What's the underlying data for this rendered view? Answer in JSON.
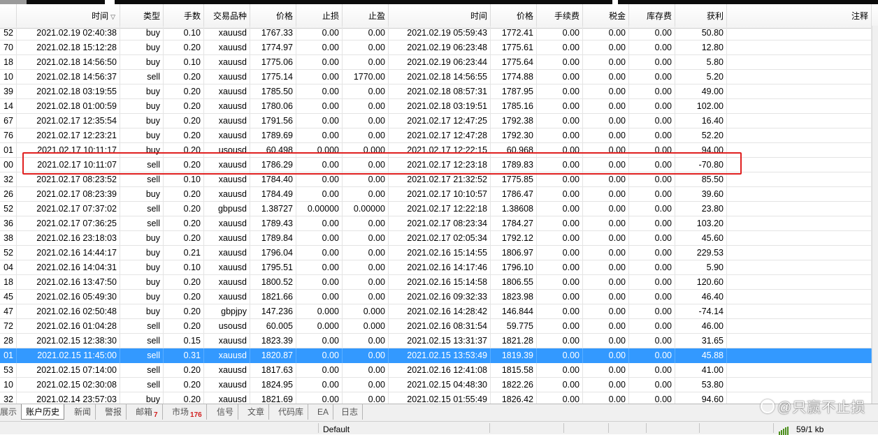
{
  "columns": [
    {
      "key": "order",
      "label": ""
    },
    {
      "key": "open_time",
      "label": "时间"
    },
    {
      "key": "type",
      "label": "类型"
    },
    {
      "key": "lots",
      "label": "手数"
    },
    {
      "key": "symbol",
      "label": "交易品种"
    },
    {
      "key": "open_price",
      "label": "价格"
    },
    {
      "key": "sl",
      "label": "止损"
    },
    {
      "key": "tp",
      "label": "止盈"
    },
    {
      "key": "close_time",
      "label": "时间"
    },
    {
      "key": "close_price",
      "label": "价格"
    },
    {
      "key": "commission",
      "label": "手续费"
    },
    {
      "key": "tax",
      "label": "税金"
    },
    {
      "key": "swap",
      "label": "库存费"
    },
    {
      "key": "profit",
      "label": "获利"
    },
    {
      "key": "comment",
      "label": "注释"
    }
  ],
  "sort_icon": "sort-desc-icon",
  "sort_glyph": "▽",
  "rows": [
    [
      "52",
      "2021.02.19 02:40:38",
      "buy",
      "0.10",
      "xauusd",
      "1767.33",
      "0.00",
      "0.00",
      "2021.02.19 05:59:43",
      "1772.41",
      "0.00",
      "0.00",
      "0.00",
      "50.80",
      ""
    ],
    [
      "70",
      "2021.02.18 15:12:28",
      "buy",
      "0.20",
      "xauusd",
      "1774.97",
      "0.00",
      "0.00",
      "2021.02.19 06:23:48",
      "1775.61",
      "0.00",
      "0.00",
      "0.00",
      "12.80",
      ""
    ],
    [
      "18",
      "2021.02.18 14:56:50",
      "buy",
      "0.10",
      "xauusd",
      "1775.06",
      "0.00",
      "0.00",
      "2021.02.19 06:23:44",
      "1775.64",
      "0.00",
      "0.00",
      "0.00",
      "5.80",
      ""
    ],
    [
      "10",
      "2021.02.18 14:56:37",
      "sell",
      "0.20",
      "xauusd",
      "1775.14",
      "0.00",
      "1770.00",
      "2021.02.18 14:56:55",
      "1774.88",
      "0.00",
      "0.00",
      "0.00",
      "5.20",
      ""
    ],
    [
      "39",
      "2021.02.18 03:19:55",
      "buy",
      "0.20",
      "xauusd",
      "1785.50",
      "0.00",
      "0.00",
      "2021.02.18 08:57:31",
      "1787.95",
      "0.00",
      "0.00",
      "0.00",
      "49.00",
      ""
    ],
    [
      "14",
      "2021.02.18 01:00:59",
      "buy",
      "0.20",
      "xauusd",
      "1780.06",
      "0.00",
      "0.00",
      "2021.02.18 03:19:51",
      "1785.16",
      "0.00",
      "0.00",
      "0.00",
      "102.00",
      ""
    ],
    [
      "67",
      "2021.02.17 12:35:54",
      "buy",
      "0.20",
      "xauusd",
      "1791.56",
      "0.00",
      "0.00",
      "2021.02.17 12:47:25",
      "1792.38",
      "0.00",
      "0.00",
      "0.00",
      "16.40",
      ""
    ],
    [
      "76",
      "2021.02.17 12:23:21",
      "buy",
      "0.20",
      "xauusd",
      "1789.69",
      "0.00",
      "0.00",
      "2021.02.17 12:47:28",
      "1792.30",
      "0.00",
      "0.00",
      "0.00",
      "52.20",
      ""
    ],
    [
      "01",
      "2021.02.17 10:11:17",
      "buy",
      "0.20",
      "usousd",
      "60.498",
      "0.000",
      "0.000",
      "2021.02.17 12:22:15",
      "60.968",
      "0.00",
      "0.00",
      "0.00",
      "94.00",
      ""
    ],
    [
      "00",
      "2021.02.17 10:11:07",
      "sell",
      "0.20",
      "xauusd",
      "1786.29",
      "0.00",
      "0.00",
      "2021.02.17 12:23:18",
      "1789.83",
      "0.00",
      "0.00",
      "0.00",
      "-70.80",
      ""
    ],
    [
      "32",
      "2021.02.17 08:23:52",
      "sell",
      "0.10",
      "xauusd",
      "1784.40",
      "0.00",
      "0.00",
      "2021.02.17 21:32:52",
      "1775.85",
      "0.00",
      "0.00",
      "0.00",
      "85.50",
      ""
    ],
    [
      "26",
      "2021.02.17 08:23:39",
      "buy",
      "0.20",
      "xauusd",
      "1784.49",
      "0.00",
      "0.00",
      "2021.02.17 10:10:57",
      "1786.47",
      "0.00",
      "0.00",
      "0.00",
      "39.60",
      ""
    ],
    [
      "52",
      "2021.02.17 07:37:02",
      "sell",
      "0.20",
      "gbpusd",
      "1.38727",
      "0.00000",
      "0.00000",
      "2021.02.17 12:22:18",
      "1.38608",
      "0.00",
      "0.00",
      "0.00",
      "23.80",
      ""
    ],
    [
      "36",
      "2021.02.17 07:36:25",
      "sell",
      "0.20",
      "xauusd",
      "1789.43",
      "0.00",
      "0.00",
      "2021.02.17 08:23:34",
      "1784.27",
      "0.00",
      "0.00",
      "0.00",
      "103.20",
      ""
    ],
    [
      "38",
      "2021.02.16 23:18:03",
      "buy",
      "0.20",
      "xauusd",
      "1789.84",
      "0.00",
      "0.00",
      "2021.02.17 02:05:34",
      "1792.12",
      "0.00",
      "0.00",
      "0.00",
      "45.60",
      ""
    ],
    [
      "52",
      "2021.02.16 14:44:17",
      "buy",
      "0.21",
      "xauusd",
      "1796.04",
      "0.00",
      "0.00",
      "2021.02.16 15:14:55",
      "1806.97",
      "0.00",
      "0.00",
      "0.00",
      "229.53",
      ""
    ],
    [
      "04",
      "2021.02.16 14:04:31",
      "buy",
      "0.10",
      "xauusd",
      "1795.51",
      "0.00",
      "0.00",
      "2021.02.16 14:17:46",
      "1796.10",
      "0.00",
      "0.00",
      "0.00",
      "5.90",
      ""
    ],
    [
      "18",
      "2021.02.16 13:47:50",
      "buy",
      "0.20",
      "xauusd",
      "1800.52",
      "0.00",
      "0.00",
      "2021.02.16 15:14:58",
      "1806.55",
      "0.00",
      "0.00",
      "0.00",
      "120.60",
      ""
    ],
    [
      "45",
      "2021.02.16 05:49:30",
      "buy",
      "0.20",
      "xauusd",
      "1821.66",
      "0.00",
      "0.00",
      "2021.02.16 09:32:33",
      "1823.98",
      "0.00",
      "0.00",
      "0.00",
      "46.40",
      ""
    ],
    [
      "47",
      "2021.02.16 02:50:48",
      "buy",
      "0.20",
      "gbpjpy",
      "147.236",
      "0.000",
      "0.000",
      "2021.02.16 14:28:42",
      "146.844",
      "0.00",
      "0.00",
      "0.00",
      "-74.14",
      ""
    ],
    [
      "72",
      "2021.02.16 01:04:28",
      "sell",
      "0.20",
      "usousd",
      "60.005",
      "0.000",
      "0.000",
      "2021.02.16 08:31:54",
      "59.775",
      "0.00",
      "0.00",
      "0.00",
      "46.00",
      ""
    ],
    [
      "28",
      "2021.02.15 12:38:30",
      "sell",
      "0.15",
      "xauusd",
      "1823.39",
      "0.00",
      "0.00",
      "2021.02.15 13:31:37",
      "1821.28",
      "0.00",
      "0.00",
      "0.00",
      "31.65",
      ""
    ],
    [
      "01",
      "2021.02.15 11:45:00",
      "sell",
      "0.31",
      "xauusd",
      "1820.87",
      "0.00",
      "0.00",
      "2021.02.15 13:53:49",
      "1819.39",
      "0.00",
      "0.00",
      "0.00",
      "45.88",
      ""
    ],
    [
      "53",
      "2021.02.15 07:14:00",
      "sell",
      "0.20",
      "xauusd",
      "1817.63",
      "0.00",
      "0.00",
      "2021.02.16 12:41:08",
      "1815.58",
      "0.00",
      "0.00",
      "0.00",
      "41.00",
      ""
    ],
    [
      "10",
      "2021.02.15 02:30:08",
      "sell",
      "0.20",
      "xauusd",
      "1824.95",
      "0.00",
      "0.00",
      "2021.02.15 04:48:30",
      "1822.26",
      "0.00",
      "0.00",
      "0.00",
      "53.80",
      ""
    ],
    [
      "32",
      "2021.02.14 23:57:03",
      "buy",
      "0.20",
      "xauusd",
      "1821.69",
      "0.00",
      "0.00",
      "2021.02.15 01:55:49",
      "1826.42",
      "0.00",
      "0.00",
      "0.00",
      "94.60",
      ""
    ]
  ],
  "selected_row_index": 22,
  "highlighted_row_index": 9,
  "tabs": [
    {
      "label": "展示",
      "active": false,
      "badge": ""
    },
    {
      "label": "账户历史",
      "active": true,
      "badge": ""
    },
    {
      "label": "新闻",
      "active": false,
      "badge": ""
    },
    {
      "label": "警报",
      "active": false,
      "badge": ""
    },
    {
      "label": "邮箱",
      "active": false,
      "badge": "7"
    },
    {
      "label": "市场",
      "active": false,
      "badge": "176"
    },
    {
      "label": "信号",
      "active": false,
      "badge": ""
    },
    {
      "label": "文章",
      "active": false,
      "badge": ""
    },
    {
      "label": "代码库",
      "active": false,
      "badge": ""
    },
    {
      "label": "EA",
      "active": false,
      "badge": ""
    },
    {
      "label": "日志",
      "active": false,
      "badge": ""
    }
  ],
  "status": {
    "profile": "Default",
    "traffic": "59/1 kb",
    "traffic_icon": "connection-bars-icon"
  },
  "watermark": {
    "text": "@只赢不止损",
    "icon": "weibo-style-icon"
  }
}
